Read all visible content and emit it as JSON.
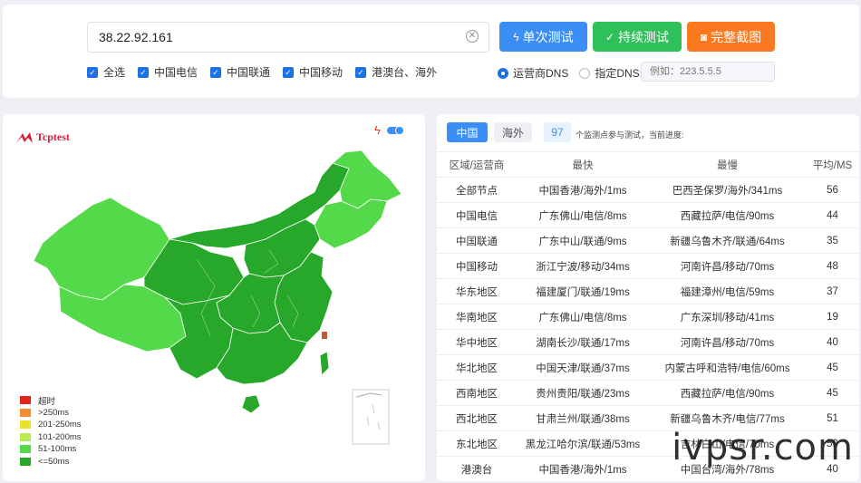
{
  "search": {
    "ip": "38.22.92.161"
  },
  "buttons": {
    "single": "单次测试",
    "continuous": "持续测试",
    "screenshot": "完整截图"
  },
  "filters": [
    "全选",
    "中国电信",
    "中国联通",
    "中国移动",
    "港澳台、海外"
  ],
  "dns": {
    "isp_label": "运营商DNS",
    "custom_label": "指定DNS:",
    "placeholder": "例如：223.5.5.5"
  },
  "logo": {
    "text": "Tcptest"
  },
  "legend": [
    {
      "label": "超时",
      "color": "#e1251b"
    },
    {
      "label": ">250ms",
      "color": "#f58d2e"
    },
    {
      "label": "201-250ms",
      "color": "#e8e32a"
    },
    {
      "label": "101-200ms",
      "color": "#b9ea54"
    },
    {
      "label": "51-100ms",
      "color": "#54d94a"
    },
    {
      "label": "<=50ms",
      "color": "#27a82a"
    }
  ],
  "tabs": {
    "china": "中国",
    "overseas": "海外"
  },
  "count": {
    "value": "97",
    "text": "个监测点参与测试，当前进度:"
  },
  "table": {
    "headers": [
      "区域/运营商",
      "最快",
      "最慢",
      "平均/MS"
    ],
    "rows": [
      [
        "全部节点",
        "中国香港/海外/1ms",
        "巴西圣保罗/海外/341ms",
        "56"
      ],
      [
        "中国电信",
        "广东佛山/电信/8ms",
        "西藏拉萨/电信/90ms",
        "44"
      ],
      [
        "中国联通",
        "广东中山/联通/9ms",
        "新疆乌鲁木齐/联通/64ms",
        "35"
      ],
      [
        "中国移动",
        "浙江宁波/移动/34ms",
        "河南许昌/移动/70ms",
        "48"
      ],
      [
        "华东地区",
        "福建厦门/联通/19ms",
        "福建漳州/电信/59ms",
        "37"
      ],
      [
        "华南地区",
        "广东佛山/电信/8ms",
        "广东深圳/移动/41ms",
        "19"
      ],
      [
        "华中地区",
        "湖南长沙/联通/17ms",
        "河南许昌/移动/70ms",
        "40"
      ],
      [
        "华北地区",
        "中国天津/联通/37ms",
        "内蒙古呼和浩特/电信/60ms",
        "45"
      ],
      [
        "西南地区",
        "贵州贵阳/联通/23ms",
        "西藏拉萨/电信/90ms",
        "45"
      ],
      [
        "西北地区",
        "甘肃兰州/联通/38ms",
        "新疆乌鲁木齐/电信/77ms",
        "51"
      ],
      [
        "东北地区",
        "黑龙江哈尔滨/联通/53ms",
        "吉林白山/电信/70ms",
        "59"
      ],
      [
        "港澳台",
        "中国香港/海外/1ms",
        "中国台湾/海外/78ms",
        "40"
      ]
    ]
  },
  "watermark": "ivpsr.com"
}
